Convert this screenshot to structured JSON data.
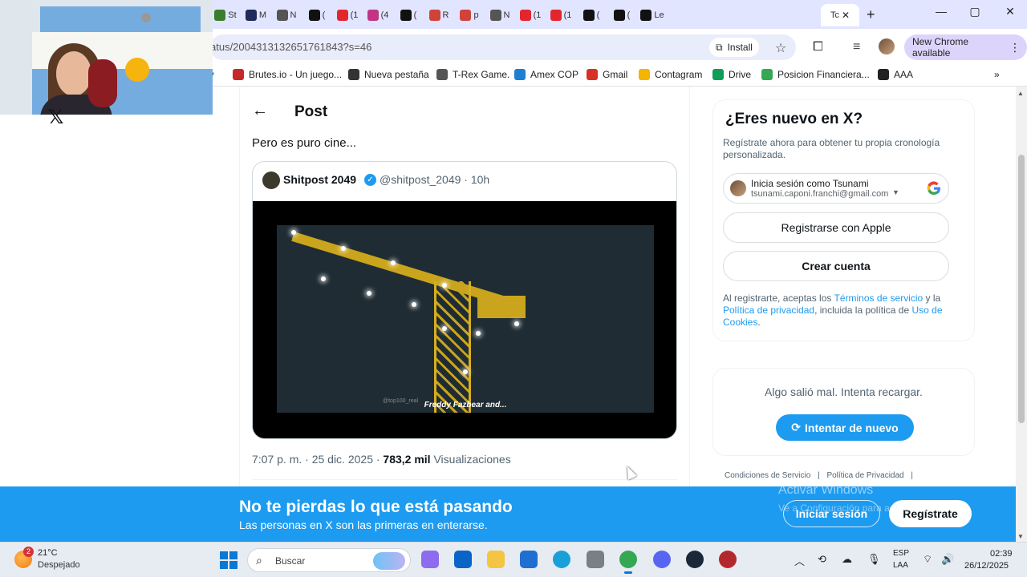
{
  "browser": {
    "tabs": [
      {
        "label": "St",
        "color": "#3a7d2c"
      },
      {
        "label": "M",
        "color": "#1f2a5a"
      },
      {
        "label": "N",
        "color": "#555555"
      },
      {
        "label": "(",
        "color": "#111111"
      },
      {
        "label": "(1",
        "color": "#e3262e"
      },
      {
        "label": "(4",
        "color": "#c13584"
      },
      {
        "label": "(",
        "color": "#111111"
      },
      {
        "label": "R",
        "color": "#d0433a"
      },
      {
        "label": "p",
        "color": "#d0433a"
      },
      {
        "label": "N",
        "color": "#555555"
      },
      {
        "label": "(1",
        "color": "#e3262e"
      },
      {
        "label": "(1",
        "color": "#e3262e"
      },
      {
        "label": "(",
        "color": "#111111"
      },
      {
        "label": "(",
        "color": "#111111"
      },
      {
        "label": "Le",
        "color": "#111111"
      }
    ],
    "active_tab": {
      "label": "Tc",
      "close": "✕"
    },
    "new_tab": "+",
    "window_controls": {
      "minimize": "—",
      "maximize": "▢",
      "close": "✕"
    },
    "url": "atus/2004313132651761843?s=46",
    "install_label": "Install",
    "new_chrome_label": "New Chrome available",
    "bookmarks": [
      {
        "label": "iv",
        "color": "#ffffff"
      },
      {
        "label": "Brutes.io - Un juego...",
        "color": "#c62828"
      },
      {
        "label": "Nueva pestaña",
        "color": "#333333"
      },
      {
        "label": "T-Rex Game.",
        "color": "#555555"
      },
      {
        "label": "Amex COP",
        "color": "#1d7fd1"
      },
      {
        "label": "Gmail",
        "color": "#d93025"
      },
      {
        "label": "Contagram",
        "color": "#f4b400"
      },
      {
        "label": "Drive",
        "color": "#0f9d58"
      },
      {
        "label": "Posicion Financiera...",
        "color": "#34a853"
      },
      {
        "label": "AAA",
        "color": "#222222"
      }
    ],
    "bookmarks_overflow": "»"
  },
  "post": {
    "header_title": "Post",
    "back_icon": "←",
    "text": "Pero es puro cine...",
    "quote": {
      "author_name": "Shitpost 2049",
      "verified_icon": "✓",
      "handle_time": "@shitpost_2049 · 10h",
      "watermark": "@top100_real",
      "caption": "Freddy Fazbear and..."
    },
    "meta_time": "7:07 p. m. · 25 dic. 2025 · ",
    "meta_views_count": "783,2 mil",
    "meta_views_label": " Visualizaciones"
  },
  "sidebar": {
    "new_title": "¿Eres nuevo en X?",
    "new_sub": "Regístrate ahora para obtener tu propia cronología personalizada.",
    "google_line1": "Inicia sesión como Tsunami",
    "google_line2": "tsunami.caponi.franchi@gmail.com",
    "apple_label": "Registrarse con Apple",
    "create_label": "Crear cuenta",
    "legal_1": "Al registrarte, aceptas los ",
    "legal_terms": "Términos de servicio",
    "legal_2": " y la ",
    "legal_privacy": "Política de privacidad",
    "legal_3": ", incluida la política de ",
    "legal_cookies": "Uso de Cookies",
    "legal_4": ".",
    "error_text": "Algo salió mal. Intenta recargar.",
    "retry_label": "Intentar de nuevo",
    "footer_terms": "Condiciones de Servicio",
    "footer_privacy": "Política de Privacidad",
    "footer_sep": "|"
  },
  "banner": {
    "title": "No te pierdas lo que está pasando",
    "subtitle": "Las personas en X son las primeras en enterarse.",
    "login_label": "Iniciar sesión",
    "signup_label": "Regístrate"
  },
  "windows": {
    "activate_title": "Activar Windows",
    "activate_sub": "Ve a Configuración para activar Windows.",
    "weather_temp": "21°C",
    "weather_desc": "Despejado",
    "weather_badge": "2",
    "search_placeholder": "Buscar",
    "lang_1": "ESP",
    "lang_2": "LAA",
    "time": "02:39",
    "date": "26/12/2025",
    "taskbar_apps": [
      {
        "name": "copilot-app",
        "color": "#8e6cf0"
      },
      {
        "name": "outlook-app",
        "color": "#0a64c8"
      },
      {
        "name": "file-explorer-app",
        "color": "#f4c542"
      },
      {
        "name": "store-app",
        "color": "#1f6fd1"
      },
      {
        "name": "edge-app",
        "color": "#1aa0d8"
      },
      {
        "name": "settings-app",
        "color": "#7a7f87"
      },
      {
        "name": "chrome-app",
        "color": "#34a853"
      },
      {
        "name": "discord-app",
        "color": "#5865f2"
      },
      {
        "name": "steam-app",
        "color": "#1b2838"
      },
      {
        "name": "roblox-app",
        "color": "#b3282d"
      }
    ]
  },
  "colors": {
    "accent": "#1d9bf0",
    "text": "#0f1419",
    "muted": "#536471"
  }
}
